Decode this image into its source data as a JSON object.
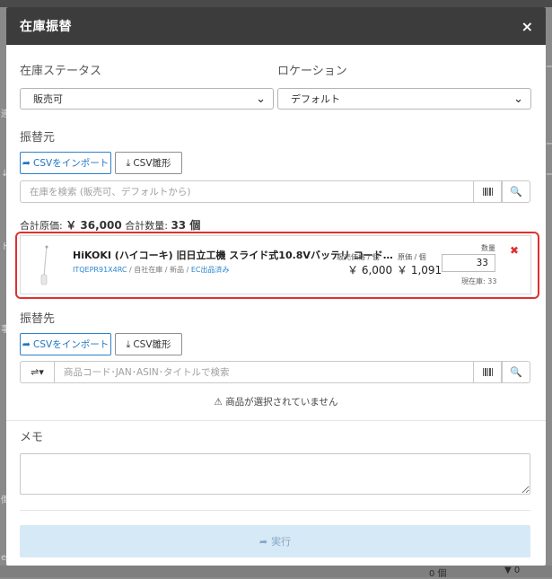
{
  "background": {
    "side_stubs": [
      "連",
      "↓",
      "ー",
      "ー",
      "ー",
      "事",
      "倒",
      "ト",
      "er"
    ],
    "bottom_values": [
      "0 個",
      "▼ 0"
    ]
  },
  "modal": {
    "title": "在庫振替",
    "close_label": "×"
  },
  "stock_status": {
    "label": "在庫ステータス",
    "selected": "販売可"
  },
  "location": {
    "label": "ロケーション",
    "selected": "デフォルト"
  },
  "source": {
    "section_title": "振替元",
    "import_button": "CSVをインポート",
    "template_button": "CSV雛形",
    "search_placeholder": "在庫を検索 (販売可、デフォルトから)",
    "totals": {
      "cost_label": "合計原価:",
      "cost_value": "￥ 36,000",
      "qty_label": "合計数量:",
      "qty_value": "33 個"
    },
    "item": {
      "name": "HiKOKI (ハイコーキ) 旧日立工機 スライド式10.8Vバッテリ コード…",
      "sku": "ITQEPR91X4RC",
      "meta_rest": " / 自社在庫 / 新品 / ",
      "meta_link": "EC出品済み",
      "sale_price_label": "販売価格 / 個",
      "sale_price": "￥ 6,000",
      "cost_label": "原価 / 個",
      "cost": "￥ 1,091",
      "qty_label": "数量",
      "qty": "33",
      "stock": "現在庫: 33",
      "remove_label": "✖"
    }
  },
  "destination": {
    "section_title": "振替先",
    "import_button": "CSVをインポート",
    "template_button": "CSV雛形",
    "search_placeholder": "商品コード･JAN･ASIN･タイトルで検索",
    "filter_label": "⇌▾",
    "empty_warning": "商品が選択されていません"
  },
  "memo": {
    "label": "メモ",
    "value": ""
  },
  "execute_button": "実行",
  "colors": {
    "header": "#3c3c3c",
    "primary": "#2f80c8",
    "highlight_border": "#e03030",
    "danger": "#d9322f",
    "execute_bg": "#d6e9f6"
  }
}
